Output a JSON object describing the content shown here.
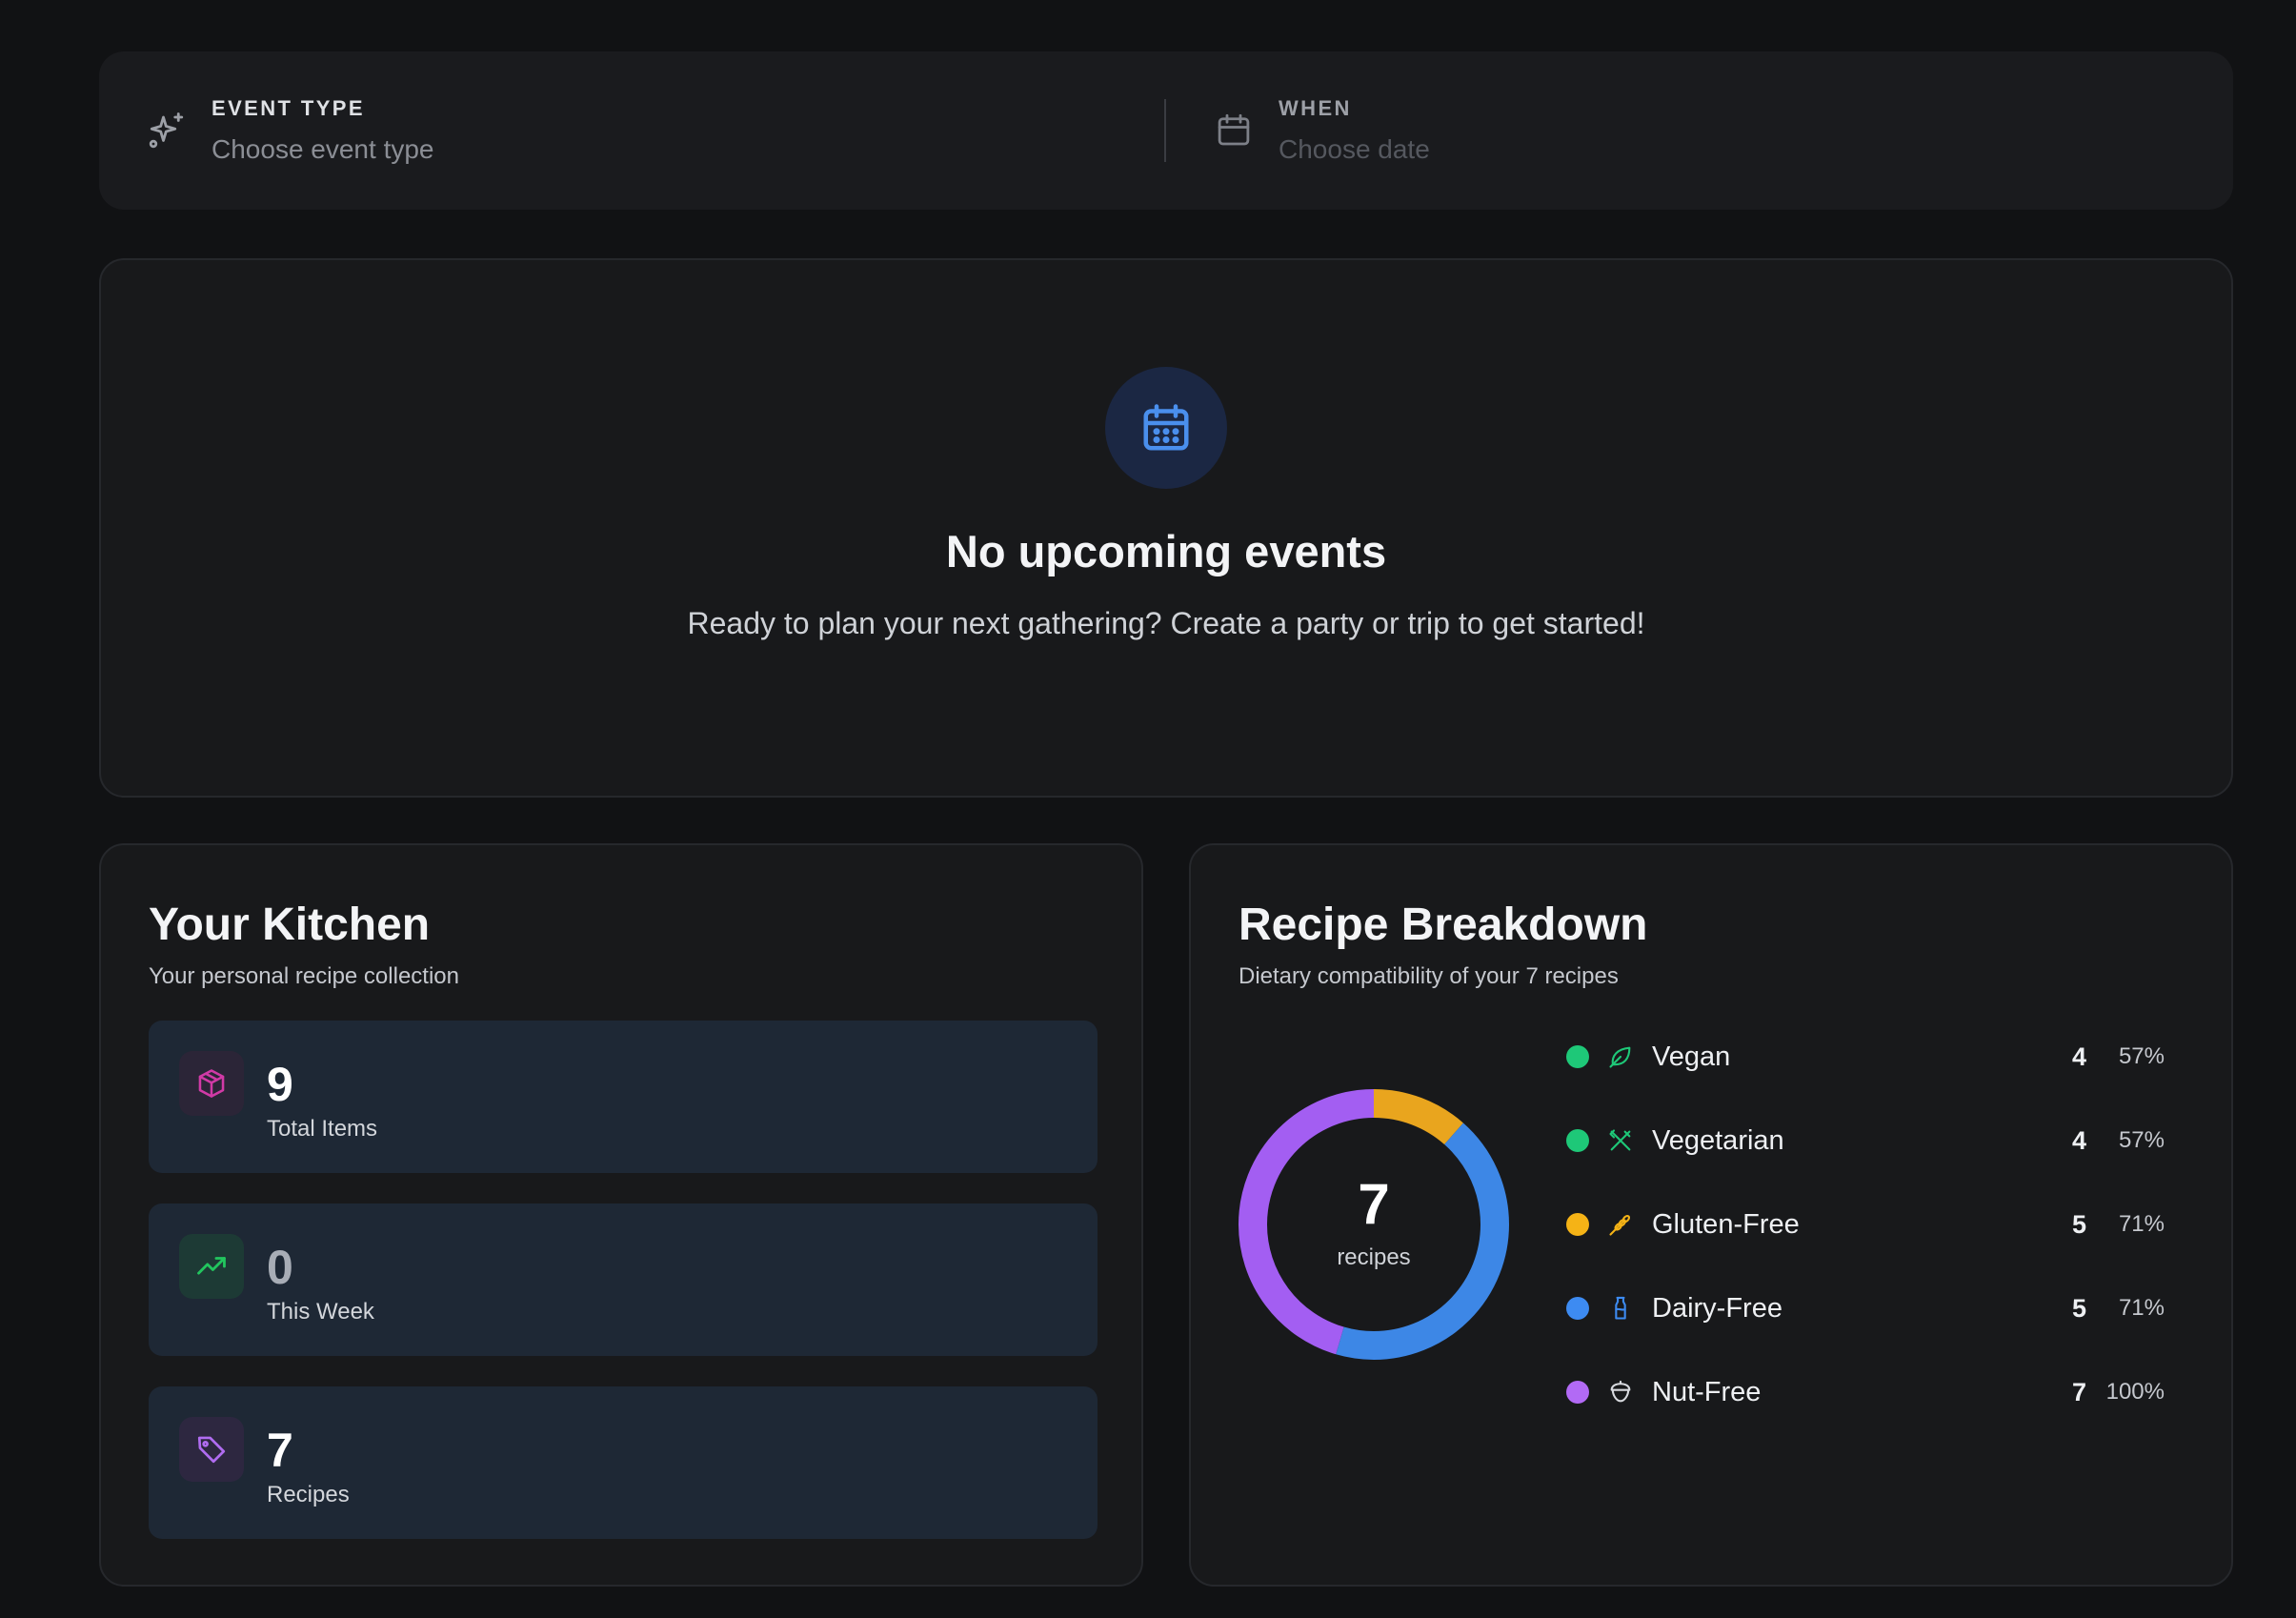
{
  "search": {
    "event_type": {
      "label": "EVENT TYPE",
      "value": "Choose event type",
      "icon": "sparkles-icon"
    },
    "when": {
      "label": "WHEN",
      "value": "Choose date",
      "icon": "calendar-icon"
    }
  },
  "events": {
    "icon": "calendar-icon",
    "title": "No upcoming events",
    "subtitle": "Ready to plan your next gathering? Create a party or trip to get started!"
  },
  "kitchen": {
    "title": "Your Kitchen",
    "subtitle": "Your personal recipe collection",
    "stats": [
      {
        "value": "9",
        "label": "Total Items",
        "icon": "package-icon",
        "color": "#d13aa6"
      },
      {
        "value": "0",
        "label": "This Week",
        "icon": "trending-up-icon",
        "color": "#22c55e"
      },
      {
        "value": "7",
        "label": "Recipes",
        "icon": "tag-icon",
        "color": "#b06cf0"
      }
    ]
  },
  "breakdown": {
    "title": "Recipe Breakdown",
    "subtitle": "Dietary compatibility of your 7 recipes",
    "total_value": "7",
    "total_label": "recipes"
  },
  "chart_data": {
    "type": "pie",
    "title": "Recipe Breakdown",
    "center_value": 7,
    "center_label": "recipes",
    "donut_segments": [
      {
        "color": "#e9a51e",
        "fraction": 0.115
      },
      {
        "color": "#3d87e6",
        "fraction": 0.43
      },
      {
        "color": "#a35ef2",
        "fraction": 0.455
      }
    ],
    "categories": [
      "Vegan",
      "Vegetarian",
      "Gluten-Free",
      "Dairy-Free",
      "Nut-Free"
    ],
    "series": [
      {
        "values": [
          4,
          4,
          5,
          5,
          7
        ]
      }
    ],
    "percentages": [
      "57%",
      "57%",
      "71%",
      "71%",
      "100%"
    ],
    "colors": [
      "#1ec878",
      "#1ec878",
      "#f5b316",
      "#3d8bf2",
      "#b26af5"
    ],
    "icons": [
      "leaf-icon",
      "utensils-crossed-icon",
      "wheat-icon",
      "milk-icon",
      "nut-icon"
    ],
    "legend": "right"
  }
}
